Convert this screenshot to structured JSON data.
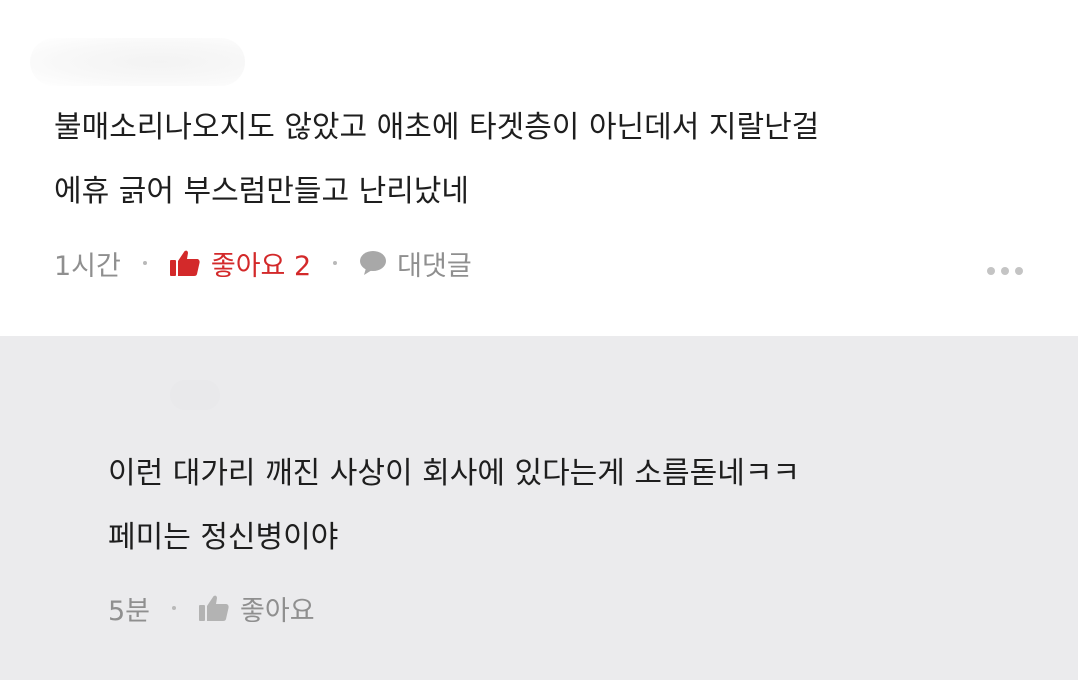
{
  "comment": {
    "lines": [
      "불매소리나오지도 않았고 애초에 타겟층이 아닌데서 지랄난걸",
      "에휴 긁어 부스럼만들고 난리났네"
    ],
    "time": "1시간",
    "like_label": "좋아요 2",
    "reply_label": "대댓글",
    "like_icon": "thumbs-up-icon",
    "reply_icon": "speech-bubble-icon",
    "more_icon": "more-dots-icon",
    "accent_color": "#d3292a"
  },
  "reply": {
    "lines": [
      "이런 대가리 깨진 사상이 회사에 있다는게 소름돋네ㅋㅋ",
      "페미는 정신병이야"
    ],
    "time": "5분",
    "like_label": "좋아요",
    "like_icon": "thumbs-up-icon"
  }
}
